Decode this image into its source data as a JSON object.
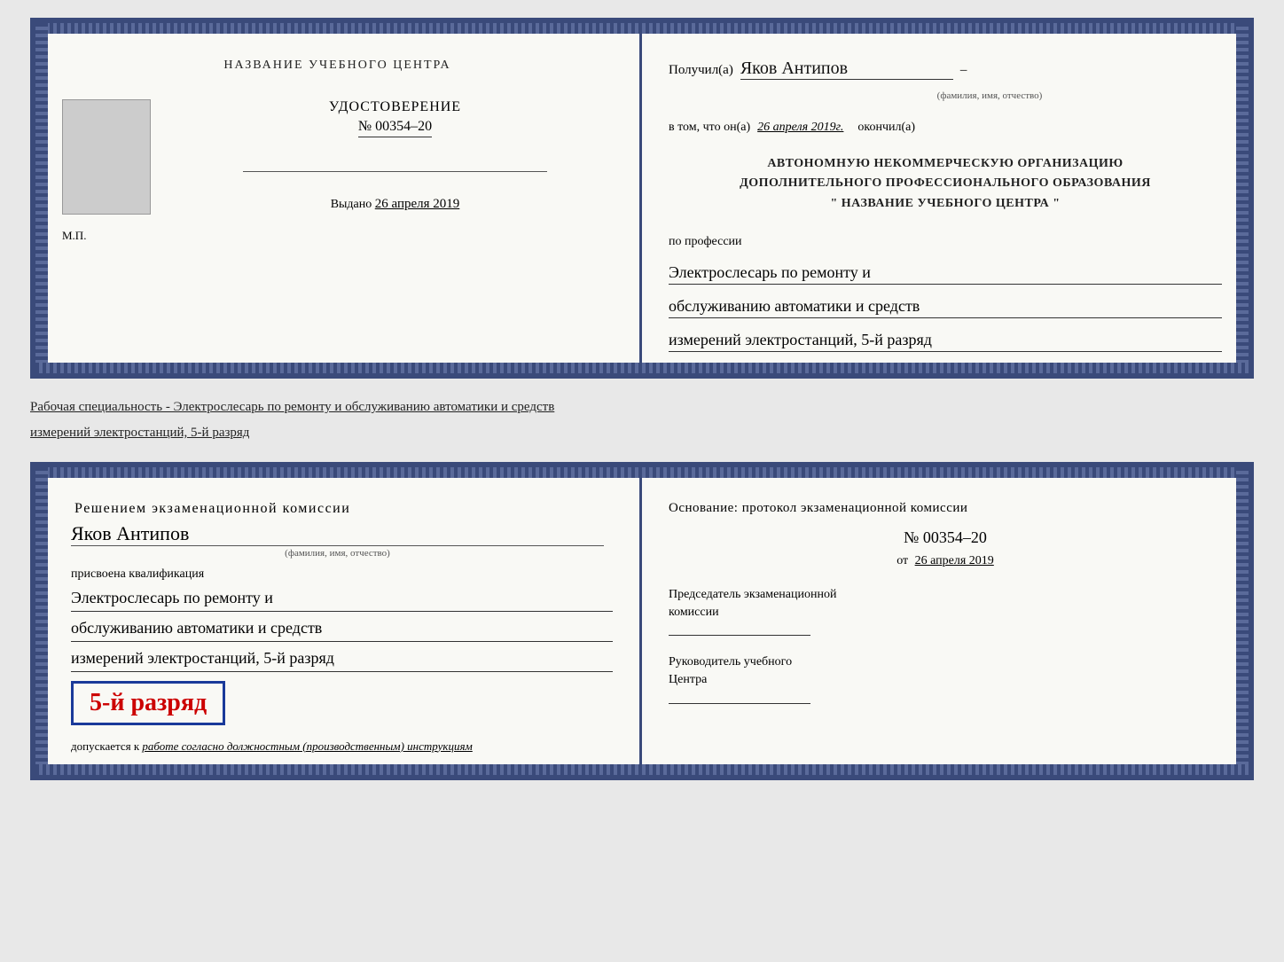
{
  "top_left": {
    "org_name": "НАЗВАНИЕ УЧЕБНОГО ЦЕНТРА",
    "udost_label": "УДОСТОВЕРЕНИЕ",
    "udost_number": "№ 00354–20",
    "vydano_label": "Выдано",
    "vydano_date": "26 апреля 2019",
    "mp_label": "М.П."
  },
  "top_right": {
    "poluchil_label": "Получил(а)",
    "recipient_name": "Яков Антипов",
    "fio_label": "(фамилия, имя, отчество)",
    "vtom_label": "в том, что он(а)",
    "vtom_date": "26 апреля 2019г.",
    "okonchil_label": "окончил(а)",
    "org_line1": "АВТОНОМНУЮ НЕКОММЕРЧЕСКУЮ ОРГАНИЗАЦИЮ",
    "org_line2": "ДОПОЛНИТЕЛЬНОГО ПРОФЕССИОНАЛЬНОГО ОБРАЗОВАНИЯ",
    "org_line3": "\"   НАЗВАНИЕ УЧЕБНОГО ЦЕНТРА   \"",
    "po_professii_label": "по профессии",
    "profession_line1": "Электрослесарь по ремонту и",
    "profession_line2": "обслуживанию автоматики и средств",
    "profession_line3": "измерений электростанций, 5-й разряд"
  },
  "middle": {
    "text": "Рабочая специальность - Электрослесарь по ремонту и обслуживанию автоматики и средств",
    "text2": "измерений электростанций, 5-й разряд"
  },
  "bottom_left": {
    "resheniem_label": "Решением экзаменационной комиссии",
    "name": "Яков Антипов",
    "fio_label": "(фамилия, имя, отчество)",
    "prisvoena_label": "присвоена квалификация",
    "qual_line1": "Электрослесарь по ремонту и",
    "qual_line2": "обслуживанию автоматики и средств",
    "qual_line3": "измерений электростанций, 5-й разряд",
    "rank_text": "5-й разряд",
    "dopuskaetsya_label": "допускается к",
    "dopuskaetsya_text": "работе согласно должностным (производственным) инструкциям"
  },
  "bottom_right": {
    "osnование_label": "Основание: протокол экзаменационной комиссии",
    "number": "№  00354–20",
    "ot_label": "от",
    "ot_date": "26 апреля 2019",
    "chairman_line1": "Председатель экзаменационной",
    "chairman_line2": "комиссии",
    "rukovoditel_line1": "Руководитель учебного",
    "rukovoditel_line2": "Центра"
  }
}
